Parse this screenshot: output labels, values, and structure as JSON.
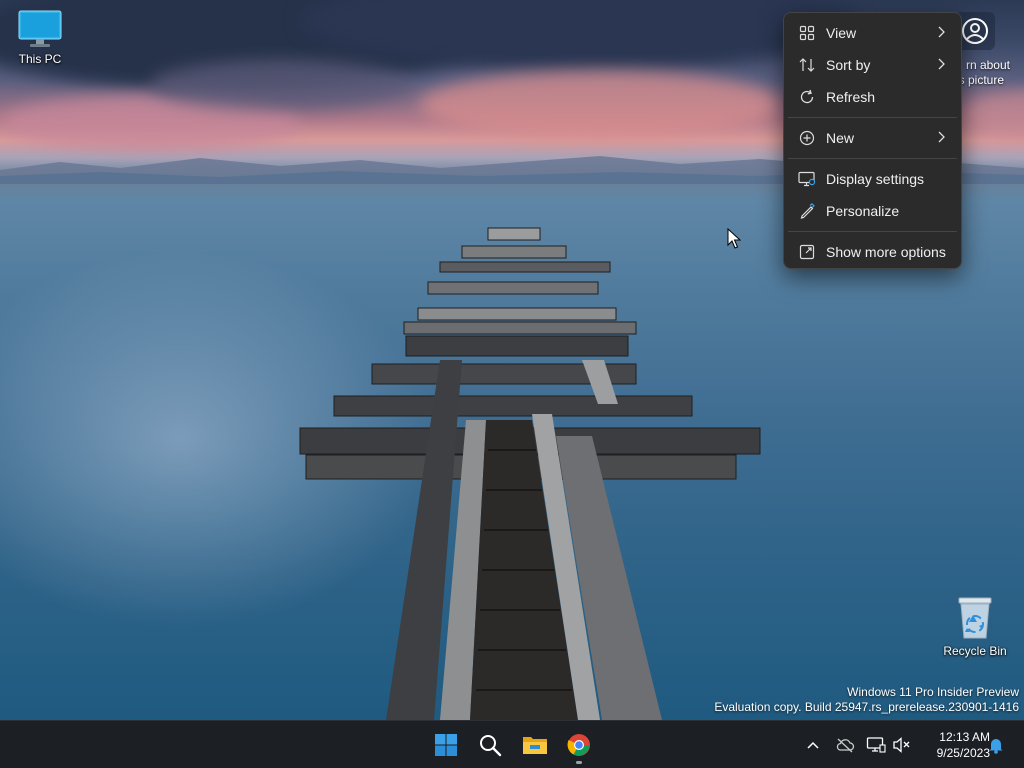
{
  "desktop": {
    "icons": [
      {
        "label": "This PC",
        "icon": "monitor-icon"
      },
      {
        "label": "Recycle Bin",
        "icon": "recycle-bin-icon"
      }
    ],
    "spotlight": {
      "label_line1": "rn about",
      "label_line2": "s picture",
      "icon": "spotlight-person-icon"
    },
    "watermark": {
      "line1": "Windows 11 Pro Insider Preview",
      "line2": "Evaluation copy. Build 25947.rs_prerelease.230901-1416"
    }
  },
  "context_menu": {
    "items": [
      {
        "label": "View",
        "icon": "grid-icon",
        "submenu": true
      },
      {
        "label": "Sort by",
        "icon": "sort-icon",
        "submenu": true
      },
      {
        "label": "Refresh",
        "icon": "refresh-icon",
        "submenu": false
      },
      {
        "label": "New",
        "icon": "plus-circle-icon",
        "submenu": true
      },
      {
        "label": "Display settings",
        "icon": "display-settings-icon",
        "submenu": false
      },
      {
        "label": "Personalize",
        "icon": "pen-icon",
        "submenu": false
      },
      {
        "label": "Show more options",
        "icon": "show-more-icon",
        "submenu": false
      }
    ]
  },
  "taskbar": {
    "apps": [
      {
        "name": "Start",
        "icon": "windows-start-icon"
      },
      {
        "name": "Search",
        "icon": "search-icon"
      },
      {
        "name": "File Explorer",
        "icon": "folder-icon"
      },
      {
        "name": "Google Chrome",
        "icon": "chrome-icon",
        "running": true
      }
    ],
    "tray": {
      "icons": [
        "chevron-up-icon",
        "cloud-off-icon",
        "network-icon",
        "volume-muted-icon",
        "bell-icon"
      ],
      "time": "12:13 AM",
      "date": "9/25/2023"
    }
  },
  "colors": {
    "menu_bg": "#2b2b2b",
    "taskbar_bg": "#1c1f24",
    "accent": "#3aa0e8"
  }
}
